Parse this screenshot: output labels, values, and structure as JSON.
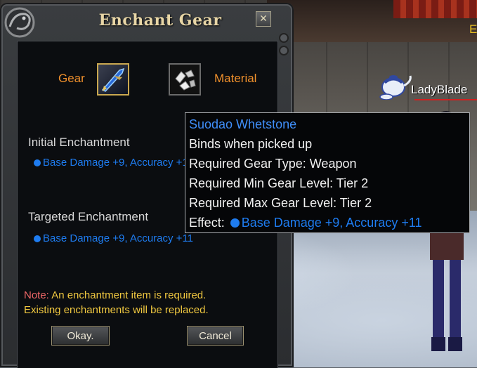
{
  "dialog": {
    "title": "Enchant Gear",
    "close_label": "✕",
    "gear_label": "Gear",
    "material_label": "Material",
    "initial_label": "Initial Enchantment",
    "initial_effect": "Base Damage +9, Accuracy +11",
    "targeted_label": "Targeted Enchantment",
    "targeted_effect": "Base Damage +9, Accuracy +11",
    "note_prefix": "Note:",
    "note_line1": " An enchantment item is required.",
    "note_line2": "Existing enchantments will be replaced.",
    "ok_label": "Okay.",
    "cancel_label": "Cancel"
  },
  "tooltip": {
    "title": "Suodao Whetstone",
    "line1": "Binds when picked up",
    "line2": "Required Gear Type: Weapon",
    "line3": "Required Min Gear Level: Tier 2",
    "line4": "Required Max Gear Level: Tier 2",
    "effect_label": "Effect:",
    "effect_value": "Base Damage +9, Accuracy +11"
  },
  "scene": {
    "character_name": "LadyBlade",
    "corner_letter": "E"
  },
  "colors": {
    "effect_blue": "#1e7cf0",
    "label_orange": "#f0902c",
    "note_yellow": "#f0c840",
    "note_red": "#f06868"
  }
}
